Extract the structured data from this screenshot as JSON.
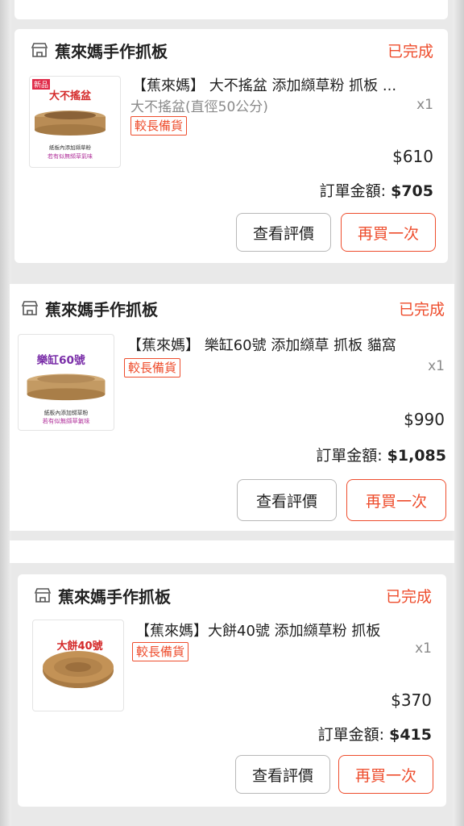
{
  "orders": [
    {
      "shop": "蕉來媽手作抓板",
      "status": "已完成",
      "title": "【蕉來媽】 大不搖盆 添加纐草粉 抓板 ...",
      "variant": "大不搖盆(直徑50公分)",
      "qty": "x1",
      "tag": "較長備貨",
      "price": "$610",
      "total_label": "訂單金額:",
      "total_value": "$705",
      "review_btn": "查看評價",
      "rebuy_btn": "再買一次",
      "thumb": {
        "badge": "新品",
        "big": "大不搖盆",
        "line1": "紙板內添加纐草粉",
        "line2": "若有似無纐草氣味"
      }
    },
    {
      "shop": "蕉來媽手作抓板",
      "status": "已完成",
      "title": "【蕉來媽】 樂缸60號 添加纐草 抓板 貓窩",
      "variant": "",
      "qty": "x1",
      "tag": "較長備貨",
      "price": "$990",
      "total_label": "訂單金額:",
      "total_value": "$1,085",
      "review_btn": "查看評價",
      "rebuy_btn": "再買一次",
      "thumb": {
        "big": "樂缸60號",
        "line1": "紙板內添加纐草粉",
        "line2": "若有似無纐草氣味"
      }
    },
    {
      "shop": "蕉來媽手作抓板",
      "status": "已完成",
      "title": "【蕉來媽】大餅40號 添加纐草粉  抓板",
      "variant": "",
      "qty": "x1",
      "tag": "較長備貨",
      "price": "$370",
      "total_label": "訂單金額:",
      "total_value": "$415",
      "review_btn": "查看評價",
      "rebuy_btn": "再買一次",
      "thumb": {
        "big": "大餅40號"
      }
    }
  ],
  "colors": {
    "accent": "#ee4d2d",
    "text": "#222222",
    "muted": "#8a8a8a",
    "bg": "#e9e9e9"
  }
}
